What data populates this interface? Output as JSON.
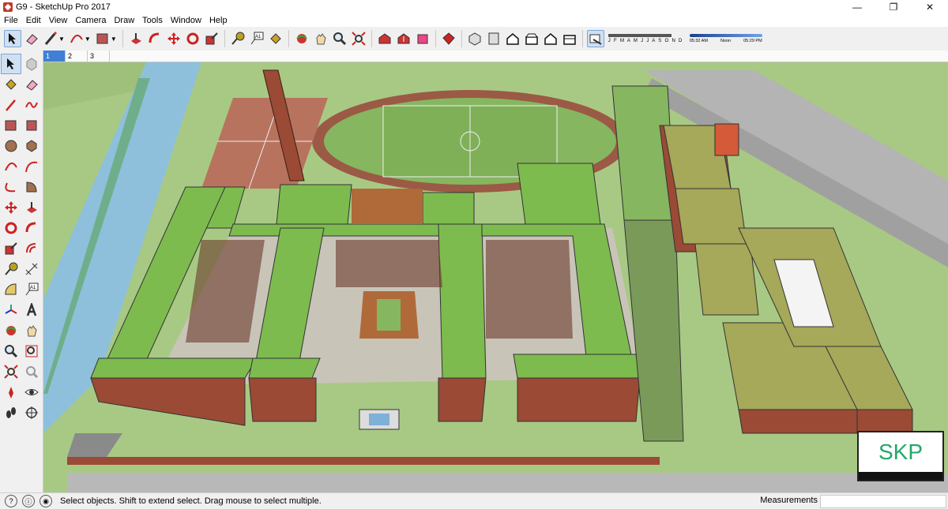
{
  "window": {
    "title": "G9 - SketchUp Pro 2017",
    "minimize": "—",
    "maximize": "❐",
    "close": "✕"
  },
  "menu": [
    "File",
    "Edit",
    "View",
    "Camera",
    "Draw",
    "Tools",
    "Window",
    "Help"
  ],
  "toolbar": {
    "shadow_months": "J F M A M J J A S O N D",
    "time_start": "05:32 AM",
    "time_mid": "Noon",
    "time_end": "05:29 PM"
  },
  "scene_tabs": [
    "1",
    "2",
    "3"
  ],
  "status": {
    "hint": "Select objects. Shift to extend select. Drag mouse to select multiple.",
    "measurements_label": "Measurements",
    "measurements_value": ""
  },
  "watermark": {
    "text": "SKP"
  },
  "colors": {
    "roof_green": "#7dbb4f",
    "brick": "#9a4a35",
    "grass": "#a8c984",
    "road": "#b4b4b4",
    "water": "#8ec0dc",
    "accent": "#3f7fd6"
  }
}
